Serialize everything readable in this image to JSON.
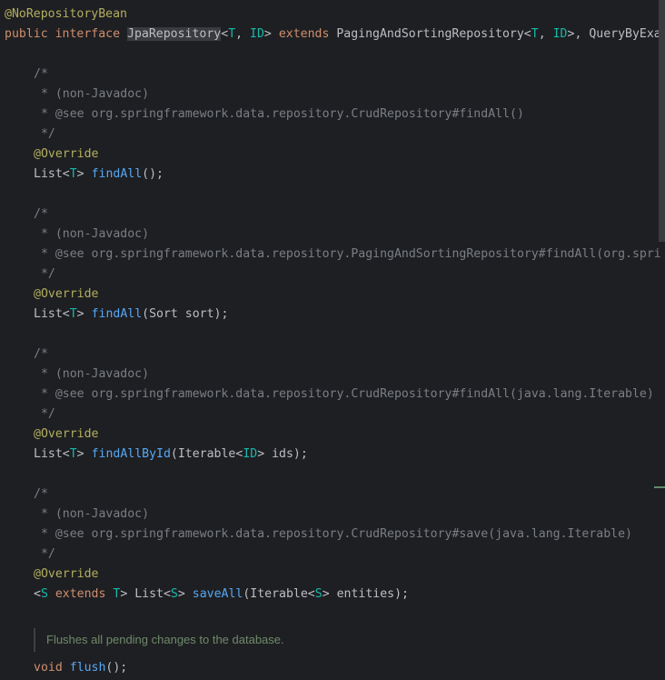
{
  "code": {
    "ann_norepo": "@NoRepositoryBean",
    "iface": {
      "kw_public": "public",
      "kw_interface": "interface",
      "name": "JpaRepository",
      "lt1": "<",
      "t1": "T",
      "comma1": ", ",
      "id1": "ID",
      "gt1": ">",
      "kw_extends": "extends",
      "paging": "PagingAndSortingRepository",
      "lt2": "<",
      "t2": "T",
      "comma2": ", ",
      "id2": "ID",
      "gt2": ">",
      "tail": ", QueryByExa"
    },
    "c_open": "/*",
    "c_nonjavadoc": " * (non-Javadoc)",
    "c_close": " */",
    "override": "@Override",
    "b1": {
      "see": " * @see org.springframework.data.repository.CrudRepository#findAll()",
      "ret": "List",
      "lt": "<",
      "t": "T",
      "gt": "> ",
      "fn": "findAll",
      "args": "();"
    },
    "b2": {
      "see": " * @see org.springframework.data.repository.PagingAndSortingRepository#findAll(org.spri",
      "ret": "List",
      "lt": "<",
      "t": "T",
      "gt": "> ",
      "fn": "findAll",
      "args": "(Sort sort);"
    },
    "b3": {
      "see": " * @see org.springframework.data.repository.CrudRepository#findAll(java.lang.Iterable)",
      "ret": "List",
      "lt": "<",
      "t": "T",
      "gt": "> ",
      "fn": "findAllById",
      "args1": "(Iterable<",
      "id": "ID",
      "args2": "> ids);"
    },
    "b4": {
      "see": " * @see org.springframework.data.repository.CrudRepository#save(java.lang.Iterable)",
      "lt": "<",
      "s1": "S",
      "kw_extends": "extends",
      "t": "T",
      "mid": "> List<",
      "s2": "S",
      "gt": "> ",
      "fn": "saveAll",
      "args1": "(Iterable<",
      "s3": "S",
      "args2": "> entities);"
    },
    "doc_flush": "Flushes all pending changes to the database.",
    "b5": {
      "kw_void": "void",
      "fn": "flush",
      "args": "();"
    }
  }
}
